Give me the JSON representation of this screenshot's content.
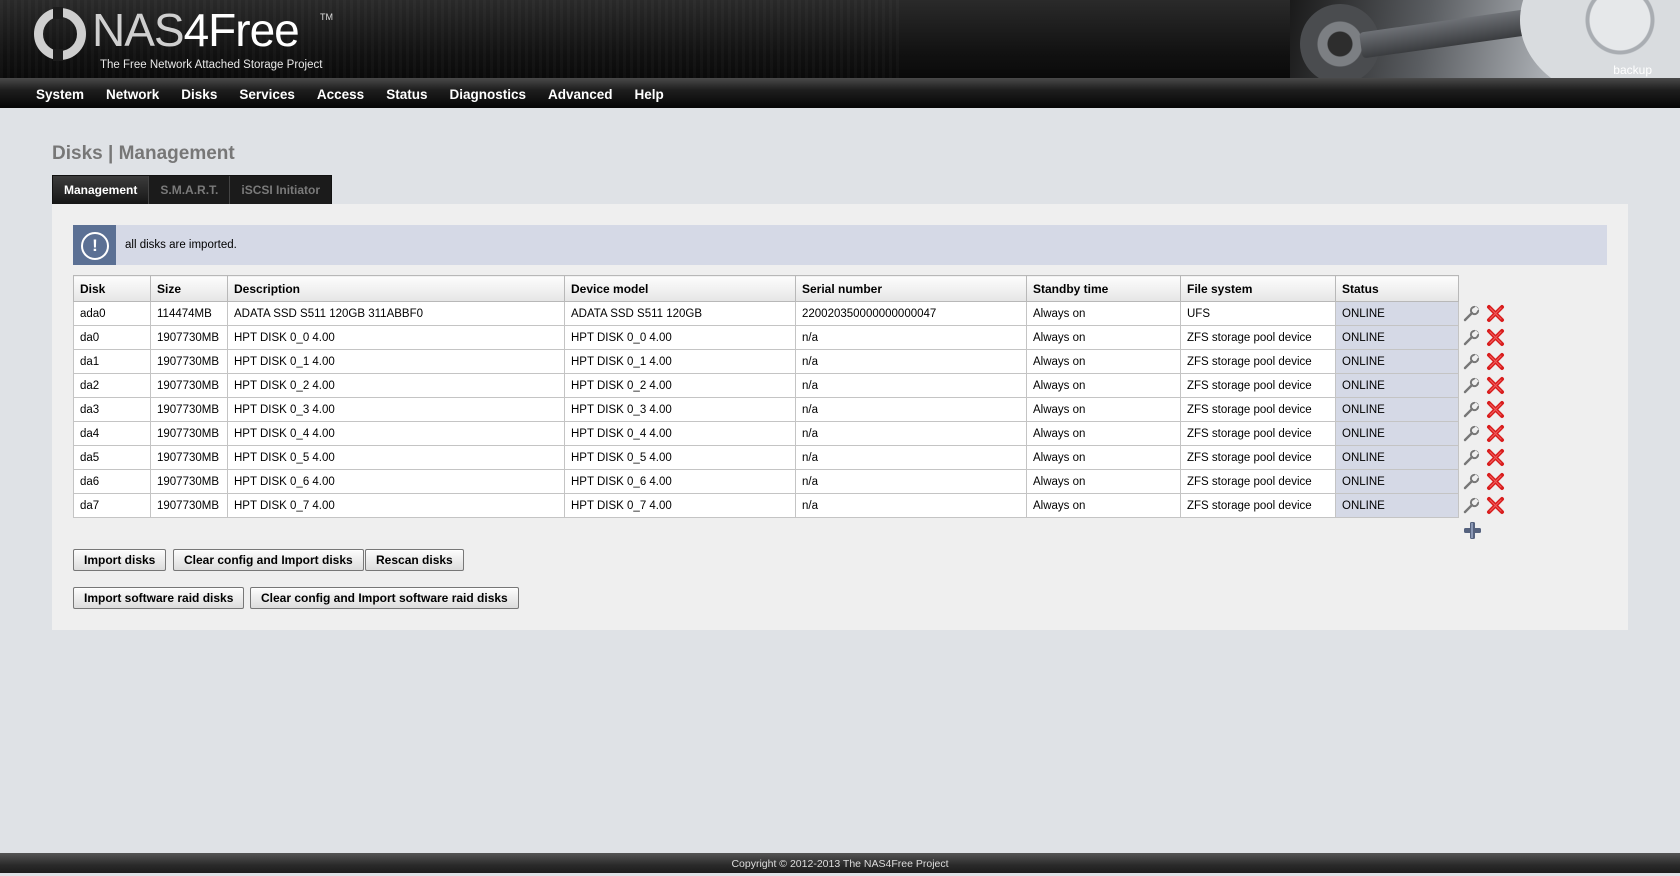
{
  "header": {
    "logo_main": "NAS",
    "logo_accent": "4Free",
    "logo_tm": "TM",
    "tagline": "The Free Network Attached Storage Project",
    "hostname": "backup"
  },
  "menu": [
    "System",
    "Network",
    "Disks",
    "Services",
    "Access",
    "Status",
    "Diagnostics",
    "Advanced",
    "Help"
  ],
  "page": {
    "title": "Disks | Management"
  },
  "tabs": [
    {
      "label": "Management",
      "active": true
    },
    {
      "label": "S.M.A.R.T.",
      "active": false
    },
    {
      "label": "iSCSI Initiator",
      "active": false
    }
  ],
  "info": {
    "icon": "info-exclamation-icon",
    "message": "all disks are imported."
  },
  "table": {
    "headers": [
      "Disk",
      "Size",
      "Description",
      "Device model",
      "Serial number",
      "Standby time",
      "File system",
      "Status"
    ],
    "rows": [
      [
        "ada0",
        "114474MB",
        "ADATA SSD S511 120GB 311ABBF0",
        "ADATA SSD S511 120GB",
        "220020350000000000047",
        "Always on",
        "UFS",
        "ONLINE"
      ],
      [
        "da0",
        "1907730MB",
        "HPT DISK 0_0 4.00",
        "HPT DISK 0_0 4.00",
        "n/a",
        "Always on",
        "ZFS storage pool device",
        "ONLINE"
      ],
      [
        "da1",
        "1907730MB",
        "HPT DISK 0_1 4.00",
        "HPT DISK 0_1 4.00",
        "n/a",
        "Always on",
        "ZFS storage pool device",
        "ONLINE"
      ],
      [
        "da2",
        "1907730MB",
        "HPT DISK 0_2 4.00",
        "HPT DISK 0_2 4.00",
        "n/a",
        "Always on",
        "ZFS storage pool device",
        "ONLINE"
      ],
      [
        "da3",
        "1907730MB",
        "HPT DISK 0_3 4.00",
        "HPT DISK 0_3 4.00",
        "n/a",
        "Always on",
        "ZFS storage pool device",
        "ONLINE"
      ],
      [
        "da4",
        "1907730MB",
        "HPT DISK 0_4 4.00",
        "HPT DISK 0_4 4.00",
        "n/a",
        "Always on",
        "ZFS storage pool device",
        "ONLINE"
      ],
      [
        "da5",
        "1907730MB",
        "HPT DISK 0_5 4.00",
        "HPT DISK 0_5 4.00",
        "n/a",
        "Always on",
        "ZFS storage pool device",
        "ONLINE"
      ],
      [
        "da6",
        "1907730MB",
        "HPT DISK 0_6 4.00",
        "HPT DISK 0_6 4.00",
        "n/a",
        "Always on",
        "ZFS storage pool device",
        "ONLINE"
      ],
      [
        "da7",
        "1907730MB",
        "HPT DISK 0_7 4.00",
        "HPT DISK 0_7 4.00",
        "n/a",
        "Always on",
        "ZFS storage pool device",
        "ONLINE"
      ]
    ],
    "row_icons": [
      "wrench-icon",
      "delete-x-icon"
    ],
    "add_icon": "add-plus-icon"
  },
  "buttons": {
    "import": "Import disks",
    "clear_import": "Clear config and Import disks",
    "rescan": "Rescan disks",
    "import_raid": "Import software raid disks",
    "clear_import_raid": "Clear config and Import software raid disks"
  },
  "footer": {
    "copyright": "Copyright © 2012-2013 The NAS4Free Project"
  },
  "colors": {
    "status_cell": "#d5d9e6",
    "info_icon_bg": "#5b7094",
    "delete_red": "#d81c1c"
  }
}
